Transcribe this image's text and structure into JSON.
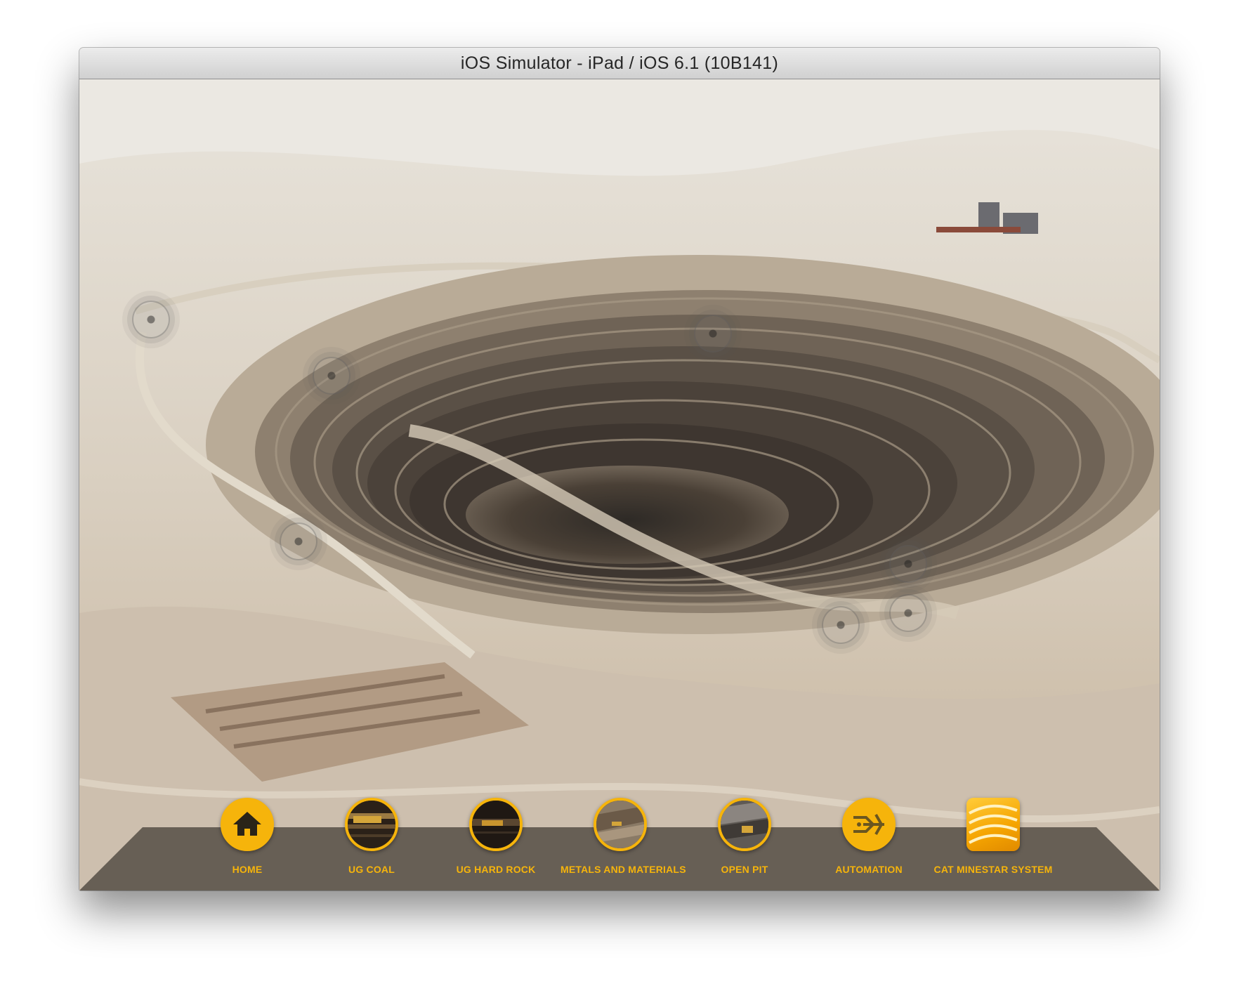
{
  "window": {
    "title": "iOS Simulator - iPad / iOS 6.1 (10B141)"
  },
  "scene": {
    "description_icon": "open-pit-mine-aerial-image",
    "hotspots": [
      {
        "id": "hotspot-1",
        "icon": "target-icon"
      },
      {
        "id": "hotspot-2",
        "icon": "target-icon"
      },
      {
        "id": "hotspot-3",
        "icon": "target-icon"
      },
      {
        "id": "hotspot-4",
        "icon": "target-icon"
      },
      {
        "id": "hotspot-5",
        "icon": "target-icon"
      },
      {
        "id": "hotspot-6",
        "icon": "target-icon"
      },
      {
        "id": "hotspot-7",
        "icon": "target-icon"
      }
    ]
  },
  "nav": {
    "accent_color": "#f6b40b",
    "items": [
      {
        "label": "HOME",
        "icon": "home-icon"
      },
      {
        "label": "UG COAL",
        "icon": "ug-coal-thumbnail"
      },
      {
        "label": "UG HARD ROCK",
        "icon": "ug-hard-rock-thumbnail"
      },
      {
        "label": "METALS AND MATERIALS",
        "icon": "metals-materials-thumbnail"
      },
      {
        "label": "OPEN PIT",
        "icon": "open-pit-thumbnail"
      },
      {
        "label": "AUTOMATION",
        "icon": "automation-icon"
      },
      {
        "label": "CAT MINESTAR SYSTEM",
        "icon": "minestar-logo-icon"
      }
    ]
  }
}
